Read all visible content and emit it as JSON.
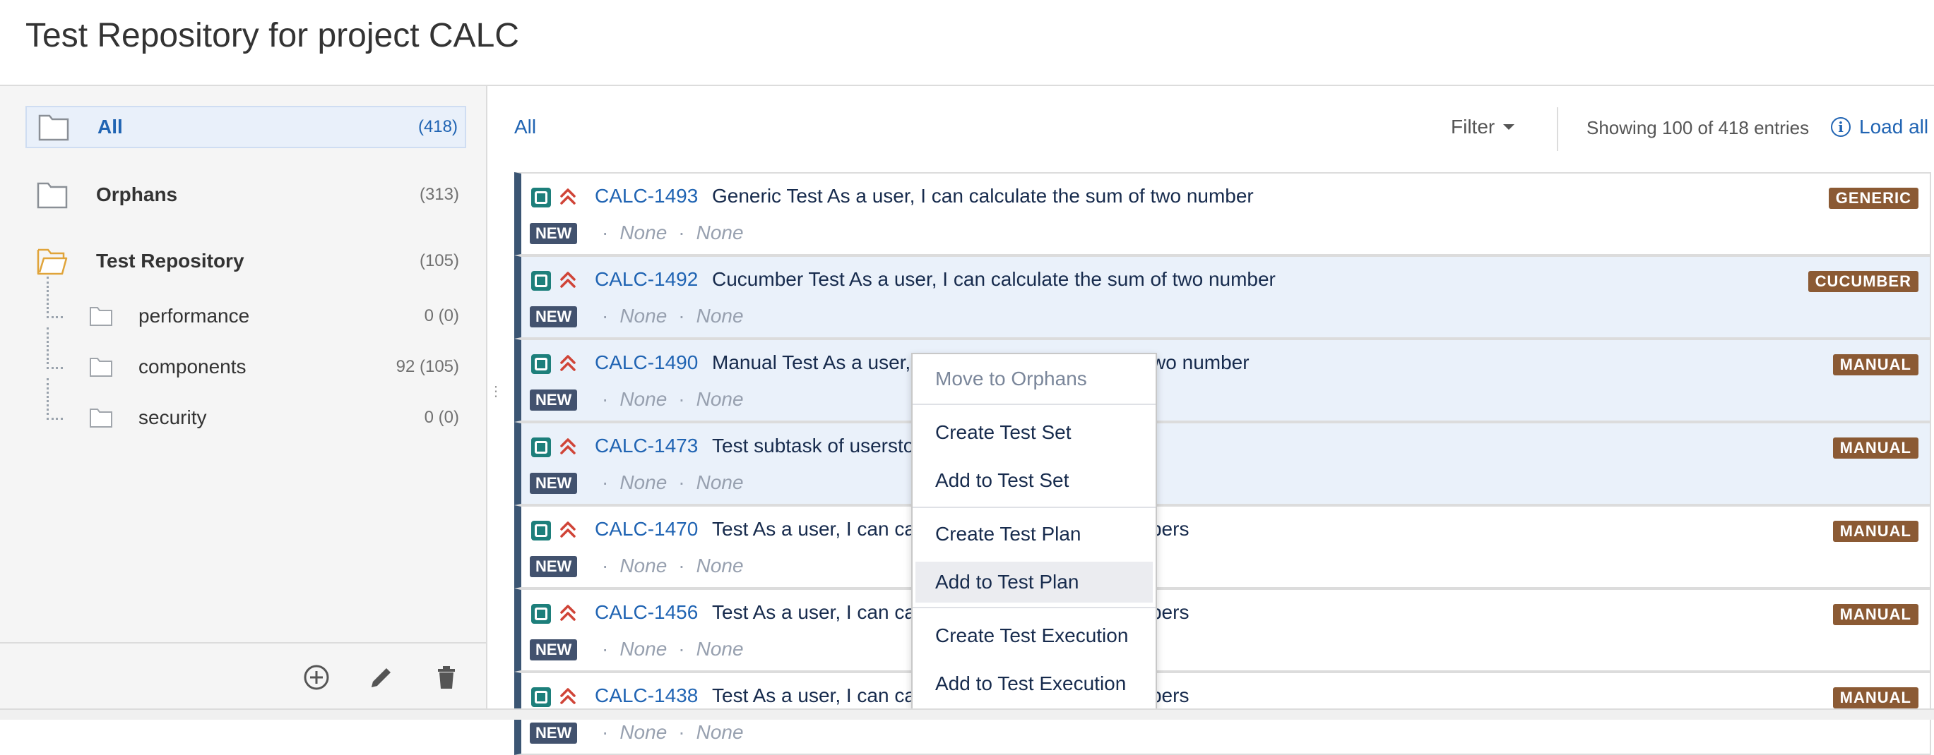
{
  "page": {
    "title": "Test Repository for project CALC"
  },
  "sidebar": {
    "folders": [
      {
        "label": "All",
        "count": "(418)"
      },
      {
        "label": "Orphans",
        "count": "(313)"
      },
      {
        "label": "Test Repository",
        "count": "(105)"
      }
    ],
    "subfolders": [
      {
        "label": "performance",
        "count": "0 (0)"
      },
      {
        "label": "components",
        "count": "92 (105)"
      },
      {
        "label": "security",
        "count": "0 (0)"
      }
    ],
    "footer_icons": [
      "add-circle-icon",
      "pencil-icon",
      "trash-icon"
    ]
  },
  "toolbar": {
    "breadcrumb": "All",
    "filter_label": "Filter",
    "showing_text": "Showing 100 of 418 entries",
    "load_all_label": "Load all",
    "info_glyph": "i"
  },
  "tests": [
    {
      "key": "CALC-1493",
      "summary": "Generic Test As a user, I can calculate the sum of two number",
      "status": "NEW",
      "meta1": "None",
      "meta2": "None",
      "type": "GENERIC"
    },
    {
      "key": "CALC-1492",
      "summary": "Cucumber Test As a user, I can calculate the sum of two number",
      "status": "NEW",
      "meta1": "None",
      "meta2": "None",
      "type": "CUCUMBER"
    },
    {
      "key": "CALC-1490",
      "summary": "Manual Test As a user, I can calculate the sum of two number",
      "status": "NEW",
      "meta1": "None",
      "meta2": "None",
      "type": "MANUAL"
    },
    {
      "key": "CALC-1473",
      "summary": "Test subtask of userstory",
      "status": "NEW",
      "meta1": "None",
      "meta2": "None",
      "type": "MANUAL"
    },
    {
      "key": "CALC-1470",
      "summary": "Test As a user, I can calculate the sum of two numbers",
      "status": "NEW",
      "meta1": "None",
      "meta2": "None",
      "type": "MANUAL"
    },
    {
      "key": "CALC-1456",
      "summary": "Test As a user, I can calculate the sum of two numbers",
      "status": "NEW",
      "meta1": "None",
      "meta2": "None",
      "type": "MANUAL"
    },
    {
      "key": "CALC-1438",
      "summary": "Test As a user, I can calculate the sum of two numbers",
      "status": "NEW",
      "meta1": "None",
      "meta2": "None",
      "type": "MANUAL"
    }
  ],
  "context_menu": {
    "items": [
      "Move to Orphans",
      "Create Test Set",
      "Add to Test Set",
      "Create Test Plan",
      "Add to Test Plan",
      "Create Test Execution",
      "Add to Test Execution"
    ]
  },
  "colors": {
    "link": "#2064b3",
    "status_badge": "#42526e",
    "type_badge": "#8b5a34",
    "test_icon": "#1d7f7b",
    "priority": "#d04437"
  }
}
